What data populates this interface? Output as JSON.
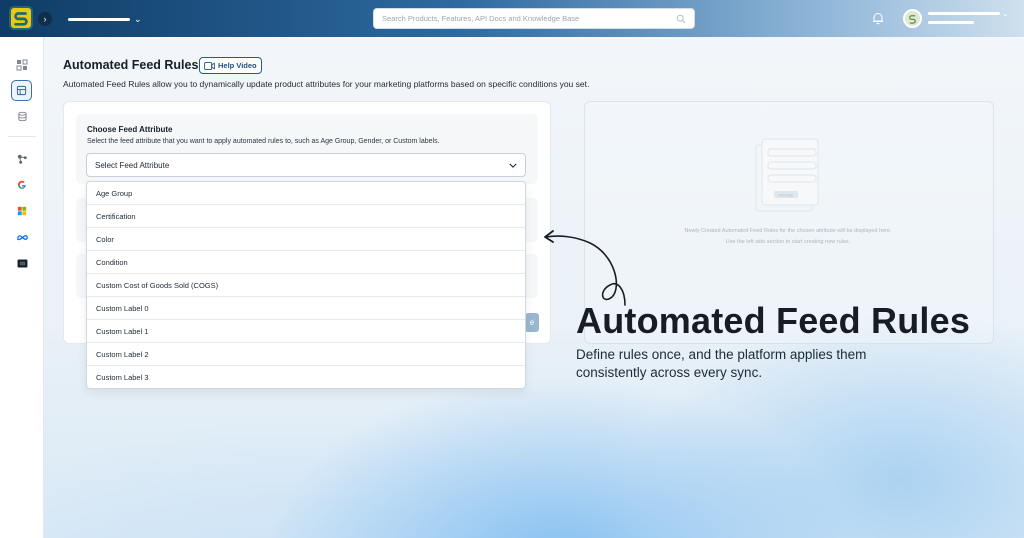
{
  "header": {
    "search_placeholder": "Search Products, Features, API Docs and Knowledge Base"
  },
  "page": {
    "title": "Automated Feed Rules",
    "help_button": "Help Video",
    "description": "Automated Feed Rules allow you to dynamically update product attributes for your marketing platforms based on specific conditions you set."
  },
  "feed_attribute": {
    "title": "Choose Feed Attribute",
    "description": "Select the feed attribute that you want to apply automated rules to, such as Age Group, Gender, or Custom labels.",
    "select_value": "Select Feed Attribute",
    "options": [
      "Age Group",
      "Certification",
      "Color",
      "Condition",
      "Custom Cost of Goods Sold (COGS)",
      "Custom Label 0",
      "Custom Label 1",
      "Custom Label 2",
      "Custom Label 3"
    ]
  },
  "preview": {
    "empty_line1": "Newly Created Automated Feed Rules for the chosen attribute will be displayed here.",
    "empty_line2": "Use the left side section to start creating new rules.",
    "illustration_button": "Add Rule"
  },
  "promo": {
    "headline": "Automated Feed Rules",
    "subline": "Define rules once, and the platform applies them consistently across every sync."
  },
  "ghost_button_text": "e",
  "icons": {
    "logo": "logo-icon",
    "search": "search-icon",
    "bell": "bell-icon",
    "chevron": "chevron-down-icon"
  }
}
